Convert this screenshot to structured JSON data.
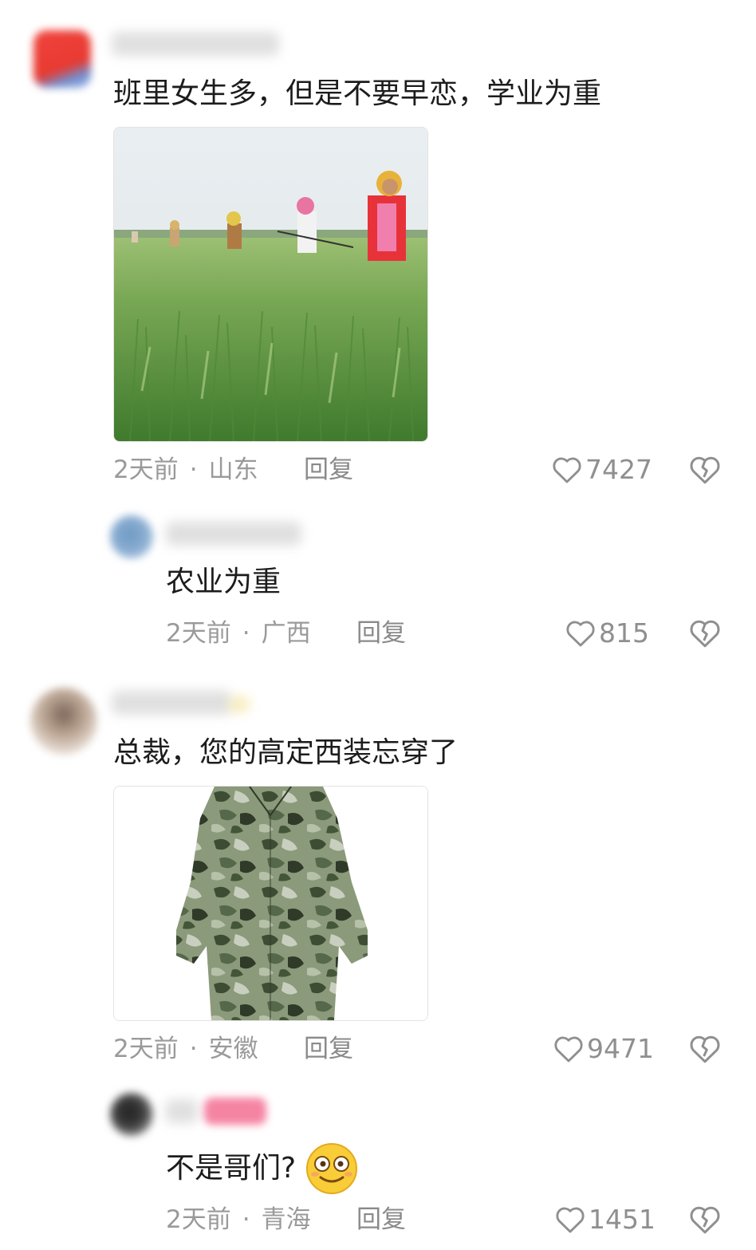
{
  "comments": [
    {
      "text": "班里女生多，但是不要早恋，学业为重",
      "time": "2天前",
      "location": "山东",
      "reply_label": "回复",
      "likes": "7427",
      "image": "wheat-field-farmers-photo",
      "replies": [
        {
          "text": "农业为重",
          "time": "2天前",
          "location": "广西",
          "reply_label": "回复",
          "likes": "815"
        }
      ]
    },
    {
      "text": "总裁，您的高定西装忘穿了",
      "time": "2天前",
      "location": "安徽",
      "reply_label": "回复",
      "likes": "9471",
      "image": "camouflage-work-coat-photo",
      "replies": [
        {
          "text": "不是哥们?",
          "emoji": "dazed-smile-emoji",
          "time": "2天前",
          "location": "青海",
          "reply_label": "回复",
          "likes": "1451"
        }
      ]
    }
  ],
  "icons": {
    "like": "heart-outline-icon",
    "dislike": "broken-heart-icon"
  },
  "colors": {
    "meta_text": "#9a9a9a",
    "body_text": "#1c1c1c"
  }
}
